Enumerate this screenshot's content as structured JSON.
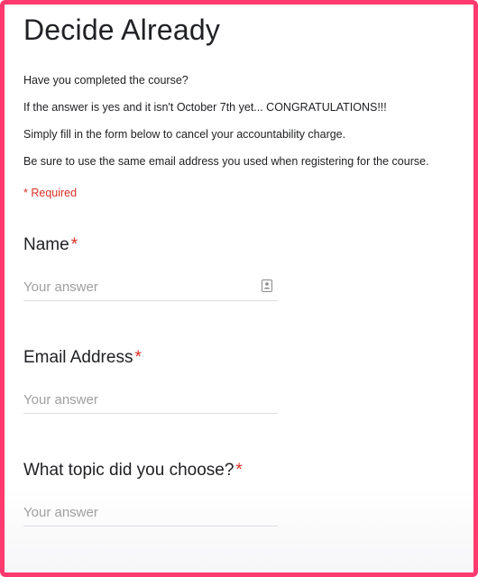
{
  "form": {
    "title": "Decide Already",
    "description": [
      "Have you completed the course?",
      "If the answer is yes and it isn't October 7th yet... CONGRATULATIONS!!!",
      "Simply fill in the form below to cancel your accountability charge.",
      "Be sure to use the same email address you used when registering for the course."
    ],
    "required_note": "* Required",
    "required_marker": "*"
  },
  "questions": [
    {
      "label": "Name",
      "placeholder": "Your answer",
      "has_contact_icon": true
    },
    {
      "label": "Email Address",
      "placeholder": "Your answer"
    },
    {
      "label": "What topic did you choose?",
      "placeholder": "Your answer"
    }
  ],
  "colors": {
    "frame_border": "#ff3a6e",
    "required_red": "#d93025",
    "text": "#202124",
    "placeholder": "#a0a0a0",
    "underline": "#dadce0"
  },
  "icons": {
    "autofill": "contact-card-icon"
  }
}
